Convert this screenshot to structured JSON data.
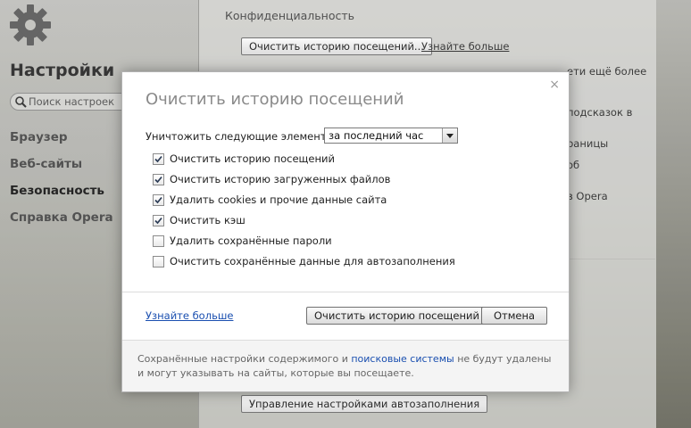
{
  "sidebar": {
    "title": "Настройки",
    "search_placeholder": "Поиск настроек",
    "items": [
      {
        "label": "Браузер"
      },
      {
        "label": "Веб-сайты"
      },
      {
        "label": "Безопасность"
      },
      {
        "label": "Справка Opera"
      }
    ]
  },
  "main": {
    "section_title": "Конфиденциальность",
    "clear_button": "Очистить историю посещений...",
    "learn_more": "Узнайте больше",
    "bg_lines": [
      "ети ещё более",
      "подсказок в",
      "раницы",
      "об",
      "в Opera"
    ],
    "autofill_button": "Управление настройками автозаполнения"
  },
  "dialog": {
    "title": "Очистить историю посещений",
    "close": "×",
    "destroy_label": "Уничтожить следующие элементы:",
    "period": "за последний час",
    "options": [
      {
        "label": "Очистить историю посещений",
        "checked": true
      },
      {
        "label": "Очистить историю загруженных файлов",
        "checked": true
      },
      {
        "label": "Удалить cookies и прочие данные сайта",
        "checked": true
      },
      {
        "label": "Очистить кэш",
        "checked": true
      },
      {
        "label": "Удалить сохранённые пароли",
        "checked": false
      },
      {
        "label": "Очистить сохранённые данные для автозаполнения",
        "checked": false
      }
    ],
    "learn_more": "Узнайте больше",
    "confirm_button": "Очистить историю посещений",
    "cancel_button": "Отмена",
    "footer_prefix": "Сохранённые настройки содержимого и",
    "footer_link": "поисковые системы",
    "footer_suffix": "не будут удалены и могут указывать на сайты, которые вы посещаете."
  },
  "icons": {
    "gear": "gear-icon",
    "search": "search-icon",
    "check": "check-icon"
  },
  "colors": {
    "link": "#1a4fb0",
    "dialog_title": "#8a8a8a"
  }
}
